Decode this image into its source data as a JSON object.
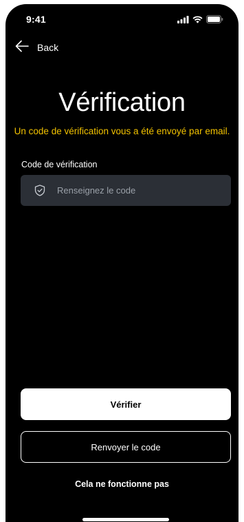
{
  "status_bar": {
    "time": "9:41",
    "icons": [
      "signal-icon",
      "wifi-icon",
      "battery-icon"
    ]
  },
  "nav": {
    "back_label": "Back",
    "back_icon": "arrow-left-icon"
  },
  "header": {
    "title": "Vérification",
    "subtitle": "Un code de vérification vous a été envoyé par email."
  },
  "form": {
    "code_label": "Code de vérification",
    "code_placeholder": "Renseignez le code",
    "code_value": "",
    "code_icon": "shield-check-icon"
  },
  "actions": {
    "verify_label": "Vérifier",
    "resend_label": "Renvoyer le code",
    "help_label": "Cela ne fonctionne pas"
  },
  "colors": {
    "background": "#000000",
    "accent": "#f2c200",
    "input_bg": "#2b2f36",
    "primary_button_bg": "#ffffff"
  }
}
